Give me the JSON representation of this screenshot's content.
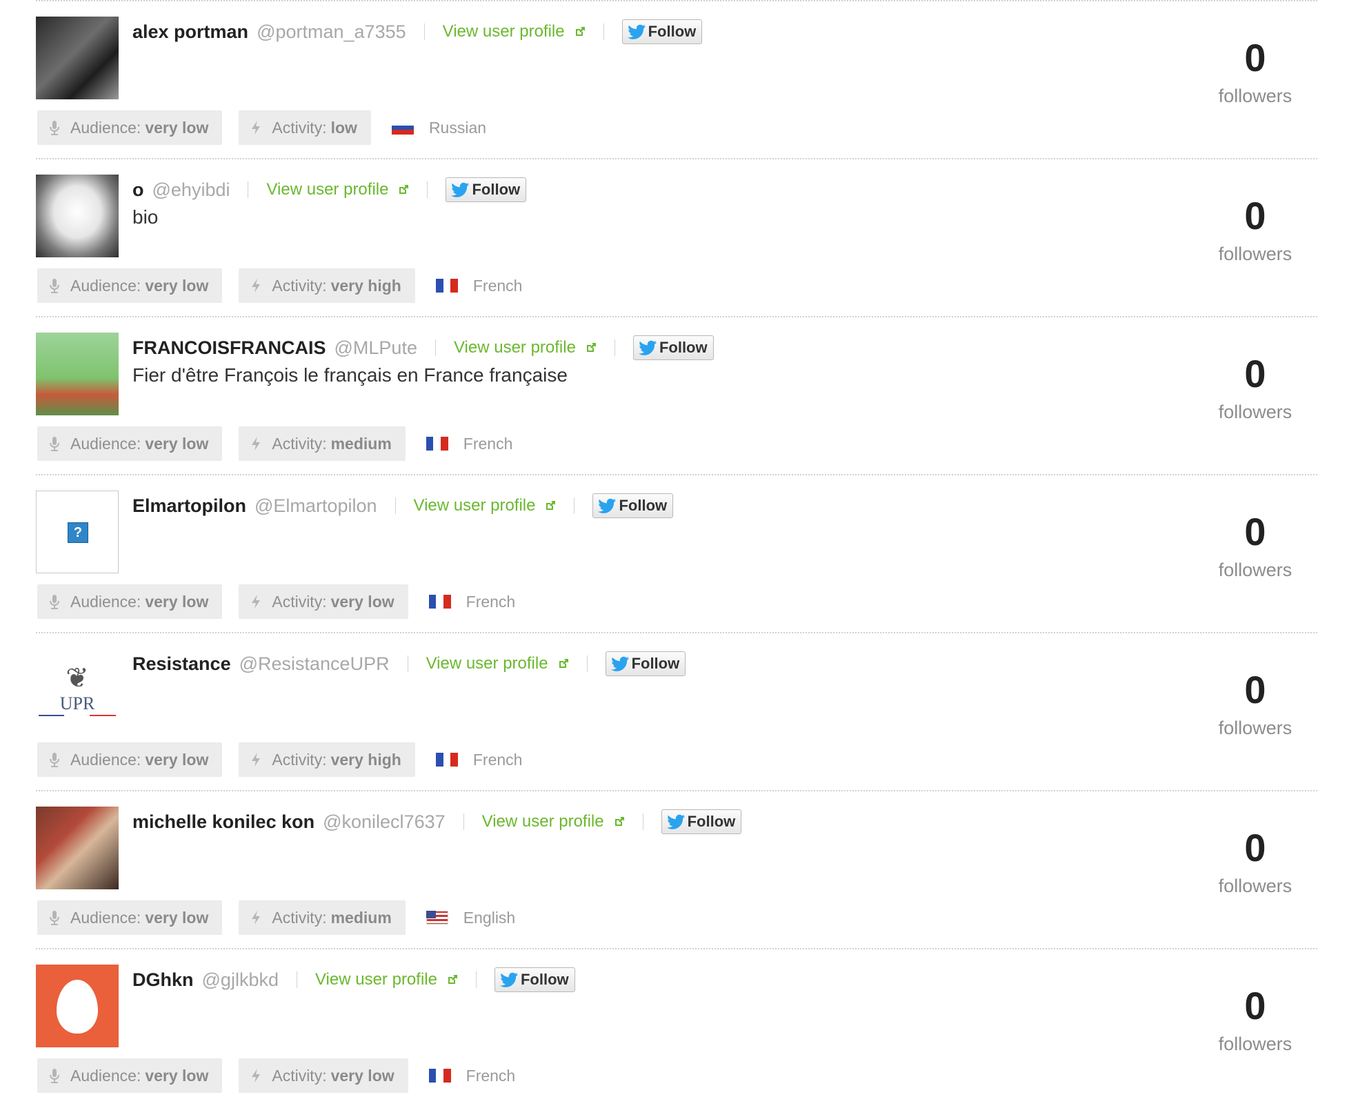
{
  "labels": {
    "view_profile": "View user profile",
    "follow": "Follow",
    "audience": "Audience:",
    "activity": "Activity:",
    "followers": "followers"
  },
  "users": [
    {
      "name": "alex portman",
      "handle": "@portman_a7355",
      "bio": "",
      "audience": "very low",
      "activity": "low",
      "language": "Russian",
      "flag": "ru",
      "followers": "0",
      "avatar": "photo"
    },
    {
      "name": "o",
      "handle": "@ehyibdi",
      "bio": "bio",
      "audience": "very low",
      "activity": "very high",
      "language": "French",
      "flag": "fr",
      "followers": "0",
      "avatar": "sketch"
    },
    {
      "name": "FRANCOISFRANCAIS",
      "handle": "@MLPute",
      "bio": "Fier d'être François le français en France française",
      "audience": "very low",
      "activity": "medium",
      "language": "French",
      "flag": "fr",
      "followers": "0",
      "avatar": "cartoon"
    },
    {
      "name": "Elmartopilon",
      "handle": "@Elmartopilon",
      "bio": "",
      "audience": "very low",
      "activity": "very low",
      "language": "French",
      "flag": "fr",
      "followers": "0",
      "avatar": "broken-image"
    },
    {
      "name": "Resistance",
      "handle": "@ResistanceUPR",
      "bio": "",
      "audience": "very low",
      "activity": "very high",
      "language": "French",
      "flag": "fr",
      "followers": "0",
      "avatar": "upr-logo",
      "avatar_text": "UPR"
    },
    {
      "name": "michelle konilec kon",
      "handle": "@konilecl7637",
      "bio": "",
      "audience": "very low",
      "activity": "medium",
      "language": "English",
      "flag": "us",
      "followers": "0",
      "avatar": "couple-photo"
    },
    {
      "name": "DGhkn",
      "handle": "@gjlkbkd",
      "bio": "",
      "audience": "very low",
      "activity": "very low",
      "language": "French",
      "flag": "fr",
      "followers": "0",
      "avatar": "default-egg"
    }
  ],
  "colors": {
    "link": "#6ab82e",
    "tag_bg": "#ececec",
    "egg_bg": "#e9603b",
    "twitter": "#2aa3ef"
  }
}
